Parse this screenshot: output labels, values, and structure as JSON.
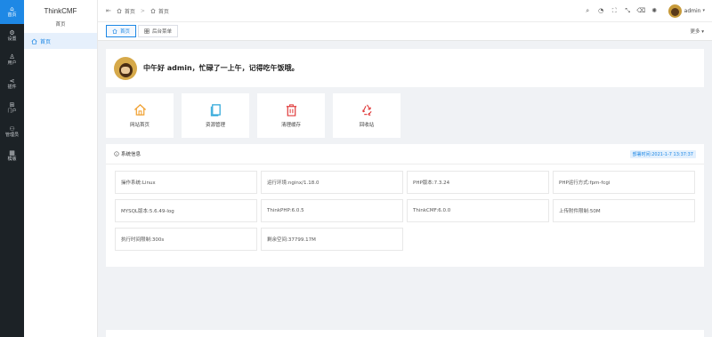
{
  "rail": {
    "items": [
      {
        "label": "首页",
        "icon": "home-icon",
        "glyph": "⌂",
        "active": true
      },
      {
        "label": "设置",
        "icon": "gear-icon",
        "glyph": "⚙",
        "active": false
      },
      {
        "label": "用户",
        "icon": "user-icon",
        "glyph": "♙",
        "active": false
      },
      {
        "label": "插件",
        "icon": "share-icon",
        "glyph": "⋖",
        "active": false
      },
      {
        "label": "门户",
        "icon": "grid-icon",
        "glyph": "⊞",
        "active": false
      },
      {
        "label": "管理员",
        "icon": "admin-icon",
        "glyph": "⚇",
        "active": false
      },
      {
        "label": "模版",
        "icon": "template-icon",
        "glyph": "▦",
        "active": false
      }
    ]
  },
  "sidebar": {
    "brand": "ThinkCMF",
    "section": "首页",
    "items": [
      {
        "label": "首页"
      }
    ]
  },
  "topbar": {
    "breadcrumb": [
      "首页",
      "首页"
    ],
    "user": "admin",
    "icons": [
      "search-icon",
      "bell-icon",
      "fullscreen-icon",
      "expand-icon",
      "clear-icon",
      "theme-icon"
    ]
  },
  "tabs": {
    "items": [
      {
        "label": "首页",
        "active": true
      },
      {
        "label": "后台菜单",
        "active": false
      }
    ],
    "more": "更多"
  },
  "welcome": {
    "text": "中午好 admin，忙碌了一上午，记得吃午饭哦。"
  },
  "quick": {
    "items": [
      {
        "label": "网站首页",
        "icon": "home-icon",
        "color": "#f0a030"
      },
      {
        "label": "资源管理",
        "icon": "file-icon",
        "color": "#2aa5d8"
      },
      {
        "label": "清理缓存",
        "icon": "trash-icon",
        "color": "#e03a3a"
      },
      {
        "label": "回收站",
        "icon": "recycle-icon",
        "color": "#e03a3a"
      }
    ]
  },
  "system": {
    "title": "系统信息",
    "deploy_time": "部署时间:2021-1-7 13:37:37",
    "items": [
      "操作系统:Linux",
      "运行环境:nginx/1.18.0",
      "PHP版本:7.3.24",
      "PHP运行方式:fpm-fcgi",
      "MYSQL版本:5.6.49-log",
      "ThinkPHP:6.0.5",
      "ThinkCMF:6.0.0",
      "上传附件限制:50M",
      "执行时间限制:300s",
      "剩余空间:37799.17M"
    ]
  },
  "colors": {
    "accent": "#1e88e5",
    "rail_bg": "#1c2226"
  }
}
